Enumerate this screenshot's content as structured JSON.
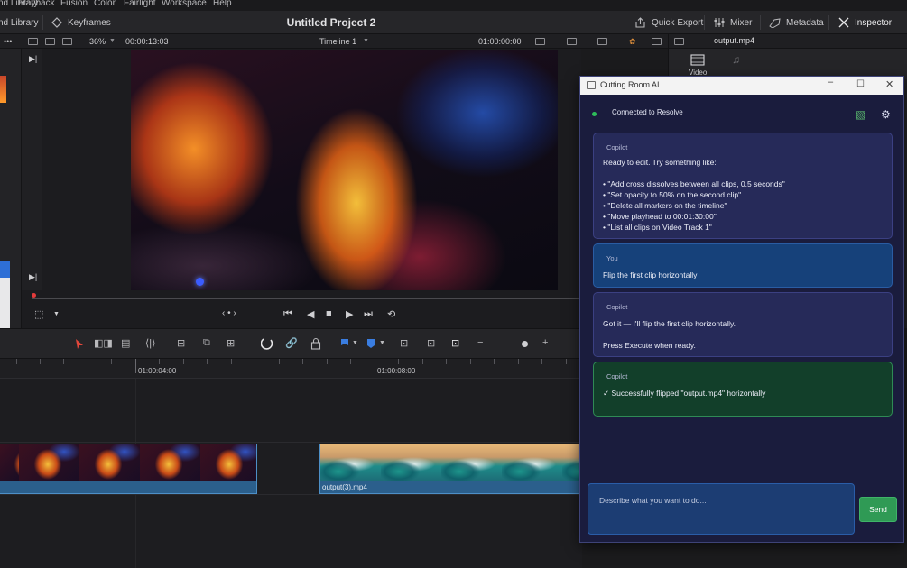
{
  "menu": {
    "items": [
      "nd Library",
      "Playback",
      "Fusion",
      "Color",
      "Fairlight",
      "Workspace",
      "Help"
    ]
  },
  "titlebar": {
    "left_items": [
      "nd Library",
      "Keyframes"
    ],
    "project_title": "Untitled Project 2",
    "right_items": [
      "Quick Export",
      "Mixer",
      "Metadata",
      "Inspector"
    ]
  },
  "viewer": {
    "zoom": "36%",
    "source_timecode": "00:00:13:03",
    "timeline_name": "Timeline 1",
    "record_timecode": "01:00:00:00",
    "inspector_clip": "output.mp4",
    "inspector_tab": "Video"
  },
  "timeline": {
    "ruler_labels": [
      "01:00:04:00",
      "01:00:08:00"
    ],
    "clips": [
      {
        "name": "",
        "kind": "fire",
        "frames": 5
      },
      {
        "name": "output(3).mp4",
        "kind": "wave",
        "frames": 5
      }
    ]
  },
  "ai_window": {
    "title": "Cutting Room AI",
    "status": "Connected to Resolve",
    "status_color": "#2ebd5a",
    "messages": [
      {
        "sender": "Copilot",
        "kind": "copilot",
        "lines": [
          "Ready to edit. Try something like:",
          "",
          "• \"Add cross dissolves between all clips, 0.5 seconds\"",
          "• \"Set opacity to 50% on the second clip\"",
          "• \"Delete all markers on the timeline\"",
          "• \"Move playhead to 00:01:30:00\"",
          "• \"List all clips on Video Track 1\""
        ]
      },
      {
        "sender": "You",
        "kind": "you",
        "lines": [
          "Flip the first clip horizontally"
        ]
      },
      {
        "sender": "Copilot",
        "kind": "copilot",
        "lines": [
          "Got it — I'll flip the first clip horizontally.",
          "",
          "Press Execute when ready."
        ]
      },
      {
        "sender": "Copilot",
        "kind": "success",
        "lines": [
          "✓ Successfully flipped \"output.mp4\" horizontally"
        ]
      }
    ],
    "input_placeholder": "Describe what you want to do...",
    "send_label": "Send"
  }
}
